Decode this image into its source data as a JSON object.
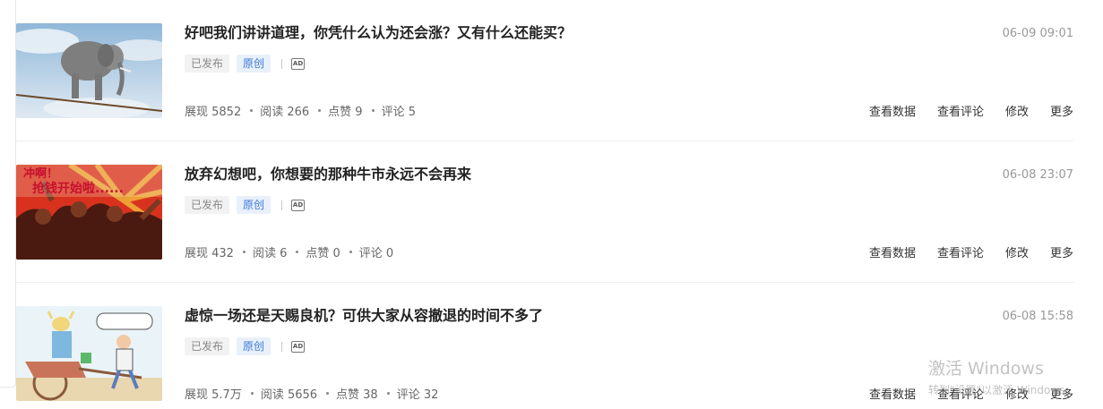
{
  "articles": [
    {
      "title": "好吧我们讲讲道理，你凭什么认为还会涨？又有什么还能买？",
      "time": "06-09 09:01",
      "status": "已发布",
      "original": "原创",
      "ad": "AD",
      "thumbnail": "elephant-on-rope",
      "stats": {
        "impressions": "展现 5852",
        "reads": "阅读 266",
        "likes": "点赞 9",
        "comments": "评论 5"
      },
      "actions": [
        "查看数据",
        "查看评论",
        "修改",
        "更多"
      ]
    },
    {
      "title": "放弃幻想吧，你想要的那种牛市永远不会再来",
      "time": "06-08 23:07",
      "status": "已发布",
      "original": "原创",
      "ad": "AD",
      "thumbnail": "propaganda-poster",
      "thumb_text_1": "冲啊！",
      "thumb_text_2": "抢钱开始啦......",
      "stats": {
        "impressions": "展现 432",
        "reads": "阅读 6",
        "likes": "点赞 0",
        "comments": "评论 0"
      },
      "actions": [
        "查看数据",
        "查看评论",
        "修改",
        "更多"
      ]
    },
    {
      "title": "虚惊一场还是天赐良机？可供大家从容撤退的时间不多了",
      "time": "06-08 15:58",
      "status": "已发布",
      "original": "原创",
      "ad": "AD",
      "thumbnail": "bull-rickshaw-cartoon",
      "stats": {
        "impressions": "展现 5.7万",
        "reads": "阅读 5656",
        "likes": "点赞 38",
        "comments": "评论 32"
      },
      "actions": [
        "查看数据",
        "查看评论",
        "修改",
        "更多"
      ]
    }
  ],
  "watermark": {
    "line1": "激活 Windows",
    "line2": "转到\"设置\"以激活 Windows。"
  }
}
